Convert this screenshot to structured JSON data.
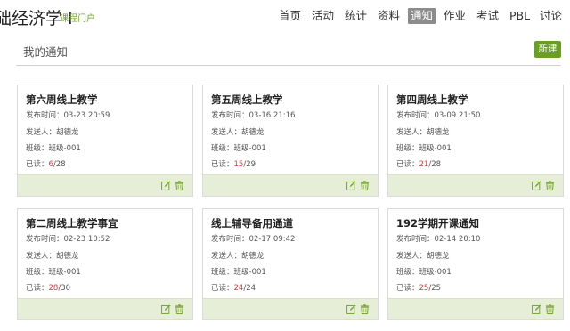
{
  "header": {
    "course_title": "础经济学 I",
    "portal_label": "课程门户",
    "nav": [
      {
        "label": "首页",
        "active": false
      },
      {
        "label": "活动",
        "active": false
      },
      {
        "label": "统计",
        "active": false
      },
      {
        "label": "资料",
        "active": false
      },
      {
        "label": "通知",
        "active": true
      },
      {
        "label": "作业",
        "active": false
      },
      {
        "label": "考试",
        "active": false
      },
      {
        "label": "PBL",
        "active": false
      },
      {
        "label": "讨论",
        "active": false
      }
    ]
  },
  "page": {
    "title": "我的通知",
    "new_button": "新建"
  },
  "labels": {
    "time": "发布时间：",
    "sender": "发送人：",
    "class": "班级：",
    "read": "已读："
  },
  "notices": [
    {
      "title": "第六周线上教学",
      "time": "03-23 20:59",
      "sender": "胡德龙",
      "class": "班级-001",
      "read": "6",
      "total": "/28"
    },
    {
      "title": "第五周线上教学",
      "time": "03-16 21:16",
      "sender": "胡德龙",
      "class": "班级-001",
      "read": "15",
      "total": "/29"
    },
    {
      "title": "第四周线上教学",
      "time": "03-09 21:50",
      "sender": "胡德龙",
      "class": "班级-001",
      "read": "21",
      "total": "/28"
    },
    {
      "title": "第二周线上教学事宜",
      "time": "02-23 10:52",
      "sender": "胡德龙",
      "class": "班级-001",
      "read": "28",
      "total": "/30"
    },
    {
      "title": "线上辅导备用通道",
      "time": "02-17 09:42",
      "sender": "胡德龙",
      "class": "班级-001",
      "read": "24",
      "total": "/24"
    },
    {
      "title": "192学期开课通知",
      "time": "02-14 20:10",
      "sender": "胡德龙",
      "class": "班级-001",
      "read": "25",
      "total": "/25"
    }
  ],
  "icons": {
    "edit": "edit-icon",
    "delete": "trash-icon"
  },
  "colors": {
    "accent": "#6aa022",
    "read_count": "#d23c3c",
    "card_footer": "#e6eed7",
    "nav_active": "#8c8c8c"
  }
}
